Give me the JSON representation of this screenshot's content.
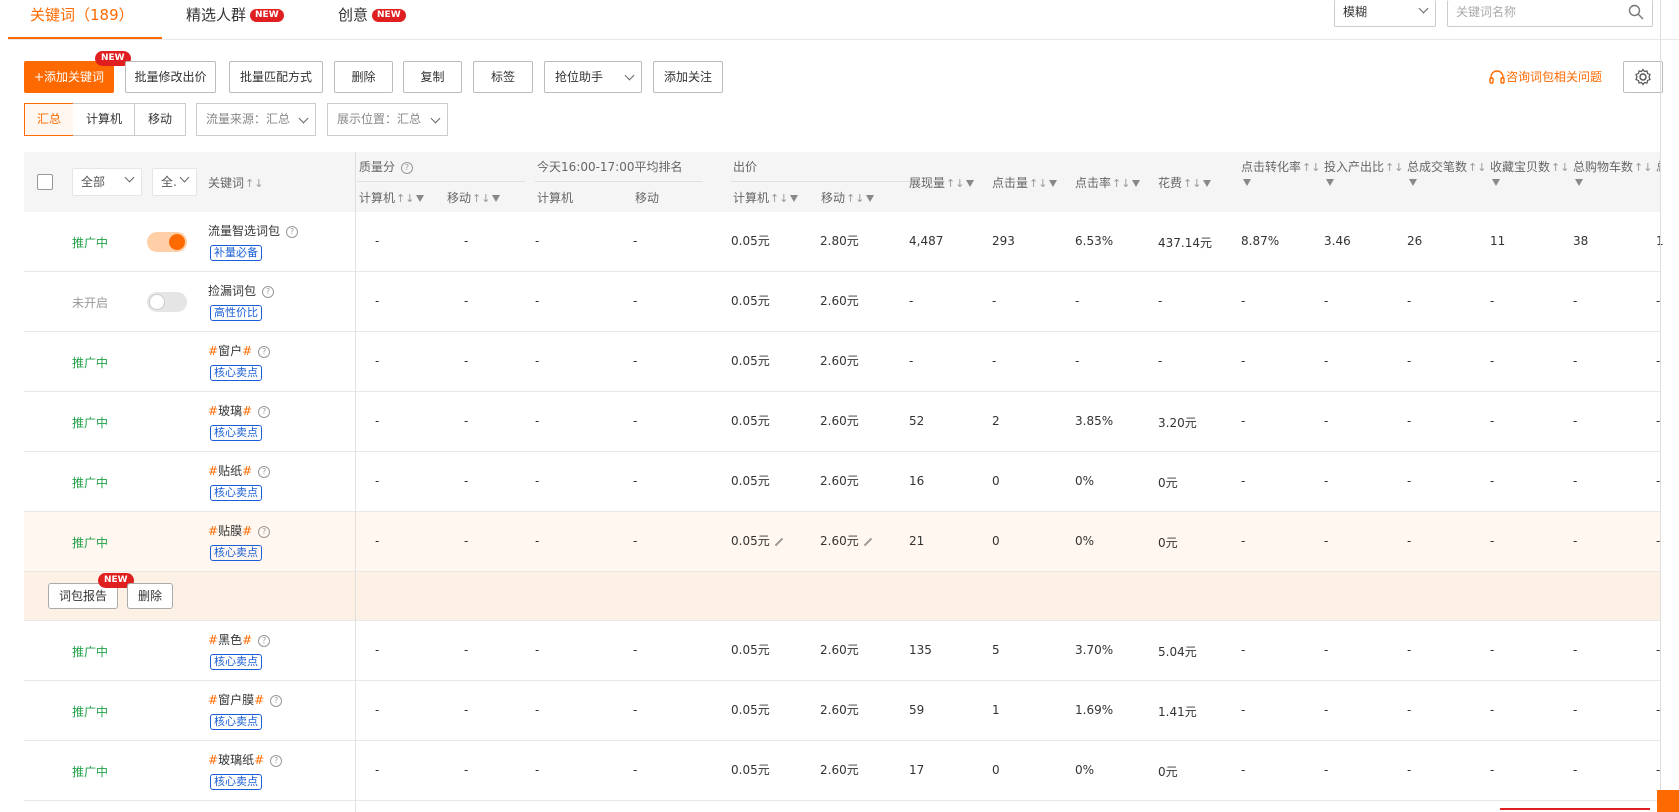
{
  "tabs": [
    {
      "label": "关键词（189）"
    },
    {
      "label": "精选人群",
      "badge": "NEW"
    },
    {
      "label": "创意",
      "badge": "NEW"
    }
  ],
  "match_select": {
    "value": "模糊"
  },
  "search": {
    "placeholder": "关键词名称"
  },
  "toolbar": {
    "add_label": "+添加关键词",
    "add_badge": "NEW",
    "buttons": [
      "批量修改出价",
      "批量匹配方式",
      "删除",
      "复制",
      "标签"
    ],
    "rank_helper": "抢位助手",
    "follow": "添加关注",
    "consult": "咨询词包相关问题"
  },
  "segments": [
    "汇总",
    "计算机",
    "移动"
  ],
  "filters": {
    "traffic": "流量来源：汇总",
    "position": "展示位置：汇总"
  },
  "header": {
    "all": "全部",
    "all2": "全.",
    "keyword": "关键词",
    "quality": "质量分",
    "rank_group": "今天16:00-17:00平均排名",
    "bid_group": "出价",
    "pc": "计算机",
    "mobile": "移动",
    "metrics": [
      "展现量",
      "点击量",
      "点击率",
      "花费",
      "点击转化率",
      "投入产出比",
      "总成交笔数",
      "收藏宝贝数",
      "总购物车数",
      "总"
    ]
  },
  "rows": [
    {
      "status": "推广中",
      "toggle": "on",
      "keyword": "流量智选词包",
      "hash": false,
      "tag": "补量必备",
      "q_pc": "-",
      "q_m": "-",
      "r_pc": "-",
      "r_m": "-",
      "bid_pc": "0.05元",
      "bid_m": "2.80元",
      "imp": "4,487",
      "clk": "293",
      "ctr": "6.53%",
      "cost": "437.14元",
      "cvr": "8.87%",
      "roi": "3.46",
      "orders": "26",
      "fav": "11",
      "cart": "38",
      "extra": "1"
    },
    {
      "status": "未开启",
      "toggle": "off",
      "keyword": "捡漏词包",
      "hash": false,
      "tag": "高性价比",
      "q_pc": "-",
      "q_m": "-",
      "r_pc": "-",
      "r_m": "-",
      "bid_pc": "0.05元",
      "bid_m": "2.60元",
      "imp": "-",
      "clk": "-",
      "ctr": "-",
      "cost": "-",
      "cvr": "-",
      "roi": "-",
      "orders": "-",
      "fav": "-",
      "cart": "-",
      "extra": "-"
    },
    {
      "status": "推广中",
      "toggle": "none",
      "keyword": "窗户",
      "hash": true,
      "tag": "核心卖点",
      "q_pc": "-",
      "q_m": "-",
      "r_pc": "-",
      "r_m": "-",
      "bid_pc": "0.05元",
      "bid_m": "2.60元",
      "imp": "-",
      "clk": "-",
      "ctr": "-",
      "cost": "-",
      "cvr": "-",
      "roi": "-",
      "orders": "-",
      "fav": "-",
      "cart": "-",
      "extra": "-"
    },
    {
      "status": "推广中",
      "toggle": "none",
      "keyword": "玻璃",
      "hash": true,
      "tag": "核心卖点",
      "q_pc": "-",
      "q_m": "-",
      "r_pc": "-",
      "r_m": "-",
      "bid_pc": "0.05元",
      "bid_m": "2.60元",
      "imp": "52",
      "clk": "2",
      "ctr": "3.85%",
      "cost": "3.20元",
      "cvr": "-",
      "roi": "-",
      "orders": "-",
      "fav": "-",
      "cart": "-",
      "extra": "-"
    },
    {
      "status": "推广中",
      "toggle": "none",
      "keyword": "贴纸",
      "hash": true,
      "tag": "核心卖点",
      "q_pc": "-",
      "q_m": "-",
      "r_pc": "-",
      "r_m": "-",
      "bid_pc": "0.05元",
      "bid_m": "2.60元",
      "imp": "16",
      "clk": "0",
      "ctr": "0%",
      "cost": "0元",
      "cvr": "-",
      "roi": "-",
      "orders": "-",
      "fav": "-",
      "cart": "-",
      "extra": "-"
    },
    {
      "status": "推广中",
      "toggle": "none",
      "keyword": "贴膜",
      "hash": true,
      "tag": "核心卖点",
      "q_pc": "-",
      "q_m": "-",
      "r_pc": "-",
      "r_m": "-",
      "bid_pc": "0.05元",
      "bid_m": "2.60元",
      "imp": "21",
      "clk": "0",
      "ctr": "0%",
      "cost": "0元",
      "cvr": "-",
      "roi": "-",
      "orders": "-",
      "fav": "-",
      "cart": "-",
      "extra": "-"
    },
    {
      "status": "推广中",
      "toggle": "none",
      "keyword": "黑色",
      "hash": true,
      "tag": "核心卖点",
      "q_pc": "-",
      "q_m": "-",
      "r_pc": "-",
      "r_m": "-",
      "bid_pc": "0.05元",
      "bid_m": "2.60元",
      "imp": "135",
      "clk": "5",
      "ctr": "3.70%",
      "cost": "5.04元",
      "cvr": "-",
      "roi": "-",
      "orders": "-",
      "fav": "-",
      "cart": "-",
      "extra": "-"
    },
    {
      "status": "推广中",
      "toggle": "none",
      "keyword": "窗户膜",
      "hash": true,
      "tag": "核心卖点",
      "q_pc": "-",
      "q_m": "-",
      "r_pc": "-",
      "r_m": "-",
      "bid_pc": "0.05元",
      "bid_m": "2.60元",
      "imp": "59",
      "clk": "1",
      "ctr": "1.69%",
      "cost": "1.41元",
      "cvr": "-",
      "roi": "-",
      "orders": "-",
      "fav": "-",
      "cart": "-",
      "extra": "-"
    },
    {
      "status": "推广中",
      "toggle": "none",
      "keyword": "玻璃纸",
      "hash": true,
      "tag": "核心卖点",
      "q_pc": "-",
      "q_m": "-",
      "r_pc": "-",
      "r_m": "-",
      "bid_pc": "0.05元",
      "bid_m": "2.60元",
      "imp": "17",
      "clk": "0",
      "ctr": "0%",
      "cost": "0元",
      "cvr": "-",
      "roi": "-",
      "orders": "-",
      "fav": "-",
      "cart": "-",
      "extra": "-"
    }
  ],
  "row_ops": {
    "report": "词包报告",
    "report_badge": "NEW",
    "delete": "删除"
  },
  "colors": {
    "accent": "#ff6a00",
    "status_on": "#21a24a",
    "tag_blue": "#1a5fd6",
    "badge_red": "#e02020"
  }
}
